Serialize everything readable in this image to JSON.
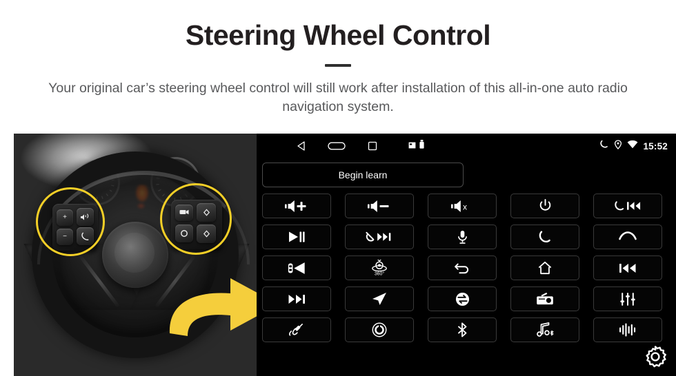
{
  "header": {
    "title": "Steering Wheel Control",
    "subtitle": "Your original car’s steering wheel control will still work after installation of this all-in-one auto radio navigation system."
  },
  "colors": {
    "highlight_yellow": "#f4cf27",
    "arrow_yellow": "#f5ce3c",
    "title_color": "#231f20",
    "subtitle_color": "#58595b",
    "screen_background": "#000000",
    "key_border": "#3a3a3a"
  },
  "photo": {
    "description": "Greyscale photo of a car steering wheel with two yellow circles highlighting the left and right steering wheel control button pads, and a yellow arrow pointing right toward the head unit screen",
    "left_pad_keys": [
      "+",
      "−",
      "voice",
      "call"
    ],
    "right_pad_keys": [
      "display",
      "up",
      "menu",
      "down"
    ]
  },
  "unit": {
    "statusbar": {
      "nav_icons": [
        "back-icon",
        "home-icon",
        "recents-icon"
      ],
      "tray_icons": [
        "sd-card-icon",
        "usb-icon"
      ],
      "right_icons": [
        "phone-icon",
        "location-icon",
        "wifi-icon"
      ],
      "time": "15:52"
    },
    "learn_button": {
      "label": "Begin learn"
    },
    "settings_icon": "gear-icon",
    "keys": [
      {
        "name": "volume-up-key",
        "icon": "volume-plus-icon"
      },
      {
        "name": "volume-down-key",
        "icon": "volume-minus-icon"
      },
      {
        "name": "mute-key",
        "icon": "volume-mute-icon"
      },
      {
        "name": "power-key",
        "icon": "power-icon"
      },
      {
        "name": "answer-prev-key",
        "icon": "phone-prev-track-icon"
      },
      {
        "name": "play-pause-key",
        "icon": "play-pause-icon"
      },
      {
        "name": "hangup-next-key",
        "icon": "hangup-next-track-icon"
      },
      {
        "name": "voice-key",
        "icon": "microphone-icon"
      },
      {
        "name": "answer-call-key",
        "icon": "phone-answer-icon"
      },
      {
        "name": "end-call-key",
        "icon": "phone-hangup-icon"
      },
      {
        "name": "rear-camera-key",
        "icon": "car-camera-icon"
      },
      {
        "name": "camera-360-key",
        "icon": "camera-360-icon"
      },
      {
        "name": "back-key",
        "icon": "return-arrow-icon"
      },
      {
        "name": "home-key",
        "icon": "house-icon"
      },
      {
        "name": "prev-track-key",
        "icon": "previous-track-icon"
      },
      {
        "name": "next-track-key",
        "icon": "next-track-icon"
      },
      {
        "name": "navigation-key",
        "icon": "navigation-arrow-icon"
      },
      {
        "name": "source-switch-key",
        "icon": "source-switch-icon"
      },
      {
        "name": "radio-key",
        "icon": "radio-icon"
      },
      {
        "name": "equalizer-key",
        "icon": "equalizer-icon"
      },
      {
        "name": "aux-key",
        "icon": "aux-cable-icon"
      },
      {
        "name": "dial-key",
        "icon": "rotary-dial-icon"
      },
      {
        "name": "bluetooth-key",
        "icon": "bluetooth-icon"
      },
      {
        "name": "bluetooth-music-key",
        "icon": "bluetooth-music-icon"
      },
      {
        "name": "voice-assistant-key",
        "icon": "sound-wave-icon"
      }
    ],
    "camera_360_label": "360°"
  }
}
